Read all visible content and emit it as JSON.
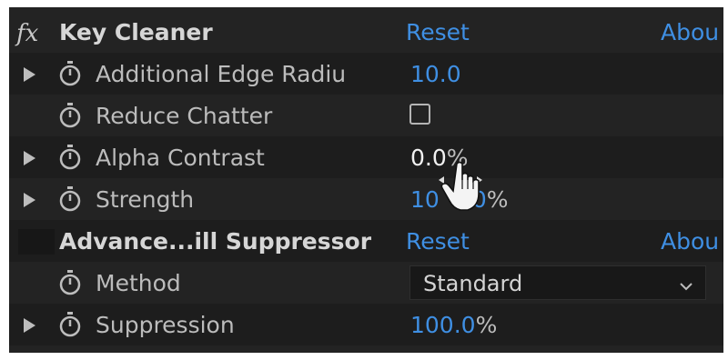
{
  "effects": [
    {
      "name": "Key Cleaner",
      "reset_label": "Reset",
      "about_label": "Abou",
      "properties": [
        {
          "name": "Additional Edge Radiu",
          "value": "10.0",
          "unit": ""
        },
        {
          "name": "Reduce Chatter",
          "control": "checkbox",
          "checked": false
        },
        {
          "name": "Alpha Contrast",
          "value": "0.0",
          "unit": "%"
        },
        {
          "name": "Strength",
          "value": "10",
          "value_rest": "0",
          "unit": "%"
        }
      ]
    },
    {
      "name": "Advance...ill Suppressor",
      "reset_label": "Reset",
      "about_label": "Abou",
      "properties": [
        {
          "name": "Method",
          "control": "dropdown",
          "value": "Standard"
        },
        {
          "name": "Suppression",
          "value": "100.0",
          "unit": "%"
        }
      ]
    }
  ],
  "icons": {
    "fx": "fx",
    "expand": "disclosure-triangle-icon",
    "stopwatch": "stopwatch-icon",
    "dropdown": "chevron-down-icon",
    "cursor": "hand-scrub-cursor-icon"
  },
  "colors": {
    "panel_bg": "#232323",
    "value_blue": "#3f8fe3",
    "label_gray": "#bcbcbc"
  }
}
